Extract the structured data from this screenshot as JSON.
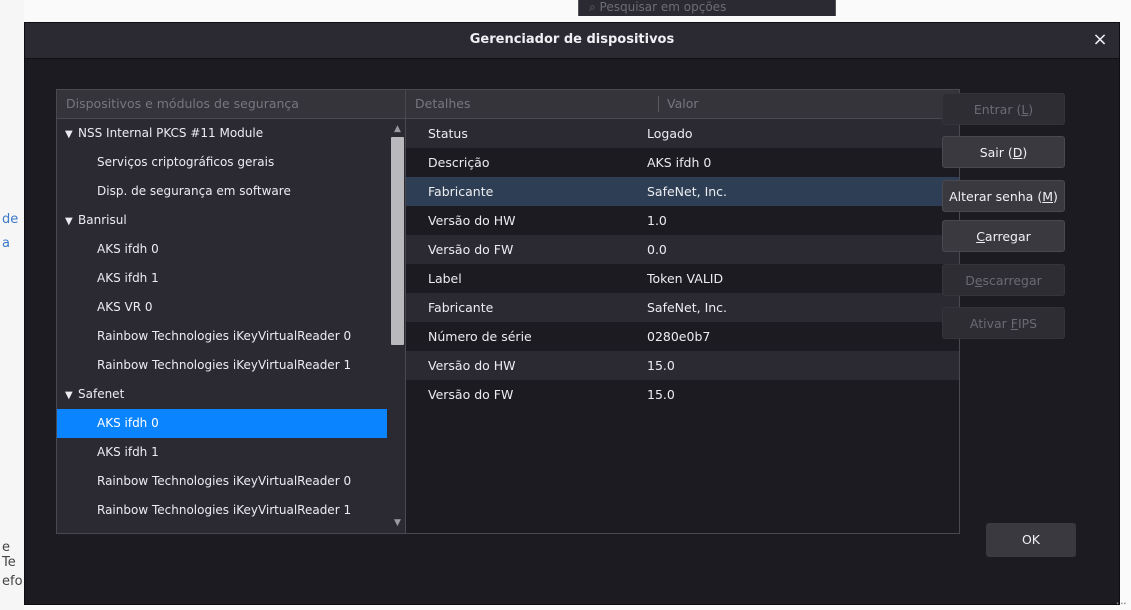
{
  "background": {
    "search_placeholder": "Pesquisar em opções",
    "frag1": "de",
    "frag2": "a",
    "frag3": "e Te",
    "frag4": "efo"
  },
  "dialog": {
    "title": "Gerenciador de dispositivos",
    "close_icon": "×"
  },
  "tree": {
    "header": "Dispositivos e módulos de segurança",
    "rows": [
      {
        "label": "NSS Internal PKCS #11 Module",
        "level": 0
      },
      {
        "label": "Serviços criptográficos gerais",
        "level": 1
      },
      {
        "label": "Disp. de segurança em software",
        "level": 1
      },
      {
        "label": "Banrisul",
        "level": 0
      },
      {
        "label": "AKS ifdh 0",
        "level": 1
      },
      {
        "label": "AKS ifdh 1",
        "level": 1
      },
      {
        "label": "AKS VR 0",
        "level": 1
      },
      {
        "label": "Rainbow Technologies iKeyVirtualReader 0",
        "level": 1
      },
      {
        "label": "Rainbow Technologies iKeyVirtualReader 1",
        "level": 1
      },
      {
        "label": "Safenet",
        "level": 0
      },
      {
        "label": "AKS ifdh 0",
        "level": 1,
        "selected": true
      },
      {
        "label": "AKS ifdh 1",
        "level": 1
      },
      {
        "label": "Rainbow Technologies iKeyVirtualReader 0",
        "level": 1
      },
      {
        "label": "Rainbow Technologies iKeyVirtualReader 1",
        "level": 1
      }
    ]
  },
  "details": {
    "col_details": "Detalhes",
    "col_value": "Valor",
    "rows": [
      {
        "key": "Status",
        "value": "Logado"
      },
      {
        "key": "Descrição",
        "value": "AKS ifdh 0"
      },
      {
        "key": "Fabricante",
        "value": "SafeNet, Inc.",
        "highlighted": true
      },
      {
        "key": "Versão do HW",
        "value": "1.0"
      },
      {
        "key": "Versão do FW",
        "value": "0.0"
      },
      {
        "key": "Label",
        "value": "Token VALID"
      },
      {
        "key": "Fabricante",
        "value": "SafeNet, Inc."
      },
      {
        "key": "Número de série",
        "value": "0280e0b7"
      },
      {
        "key": "Versão do HW",
        "value": "15.0"
      },
      {
        "key": "Versão do FW",
        "value": "15.0"
      }
    ]
  },
  "buttons": {
    "login": {
      "pre": "Entrar (",
      "key": "L",
      "post": ")",
      "enabled": false
    },
    "logout": {
      "pre": "Sair (",
      "key": "D",
      "post": ")",
      "enabled": true
    },
    "change_password": {
      "pre": "Alterar senha (",
      "key": "M",
      "post": ")",
      "enabled": true
    },
    "load": {
      "pre": "",
      "key": "C",
      "post": "arregar",
      "enabled": true
    },
    "unload": {
      "pre": "D",
      "key": "e",
      "post": "scarregar",
      "enabled": false
    },
    "enable_fips": {
      "pre": "Ativar ",
      "key": "F",
      "post": "IPS",
      "enabled": false
    },
    "ok": "OK"
  },
  "colors": {
    "dialog_bg": "#1c1b22",
    "selection": "#0a84ff",
    "row_highlight": "#2e3f55"
  }
}
